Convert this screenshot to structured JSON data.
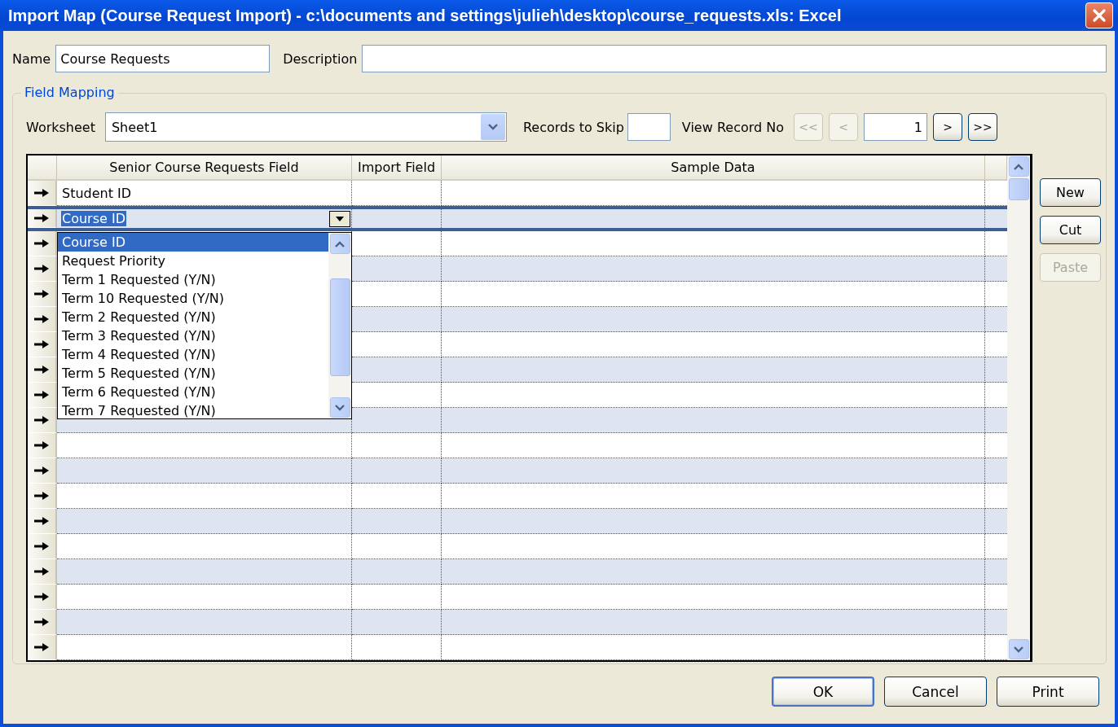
{
  "window": {
    "title": "Import Map (Course Request Import) - c:\\documents and settings\\julieh\\desktop\\course_requests.xls: Excel"
  },
  "name_field": {
    "label": "Name",
    "value": "Course Requests"
  },
  "description_field": {
    "label": "Description"
  },
  "field_mapping": {
    "legend": "Field Mapping",
    "worksheet": {
      "label": "Worksheet",
      "value": "Sheet1"
    },
    "records_to_skip": {
      "label": "Records to Skip"
    },
    "view_record": {
      "label": "View Record No",
      "value": "1",
      "buttons": [
        {
          "label": "<<",
          "disabled": true
        },
        {
          "label": "<",
          "disabled": true
        },
        {
          "label": ">",
          "disabled": false
        },
        {
          "label": ">>",
          "disabled": false
        }
      ]
    },
    "table": {
      "columns": [
        "Senior Course Requests Field",
        "Import Field",
        "Sample Data"
      ],
      "rows": [
        {
          "field": "Student ID",
          "selected": false
        },
        {
          "field": "Course ID",
          "selected": true
        },
        {
          "selected": false
        },
        {
          "selected": false
        },
        {
          "selected": false
        },
        {
          "selected": false
        },
        {
          "selected": false
        },
        {
          "selected": false
        },
        {
          "selected": false
        },
        {
          "selected": false
        },
        {
          "selected": false
        },
        {
          "selected": false
        },
        {
          "selected": false
        },
        {
          "selected": false
        },
        {
          "selected": false
        },
        {
          "selected": false
        },
        {
          "selected": false
        },
        {
          "selected": false
        },
        {
          "selected": false
        }
      ],
      "dropdown": [
        {
          "label": "Course ID",
          "selected": true
        },
        {
          "label": "Request Priority",
          "selected": false
        },
        {
          "label": "Term 1 Requested (Y/N)",
          "selected": false
        },
        {
          "label": "Term 10 Requested (Y/N)",
          "selected": false
        },
        {
          "label": "Term 2 Requested (Y/N)",
          "selected": false
        },
        {
          "label": "Term 3 Requested (Y/N)",
          "selected": false
        },
        {
          "label": "Term 4 Requested (Y/N)",
          "selected": false
        },
        {
          "label": "Term 5 Requested (Y/N)",
          "selected": false
        },
        {
          "label": "Term 6 Requested (Y/N)",
          "selected": false
        },
        {
          "label": "Term 7 Requested (Y/N)",
          "selected": false
        }
      ]
    },
    "side_buttons": [
      {
        "label": "New",
        "disabled": false
      },
      {
        "label": "Cut",
        "disabled": false
      },
      {
        "label": "Paste",
        "disabled": true
      }
    ]
  },
  "buttons": [
    {
      "label": "OK",
      "default": true
    },
    {
      "label": "Cancel",
      "default": false
    },
    {
      "label": "Print",
      "default": false
    }
  ]
}
